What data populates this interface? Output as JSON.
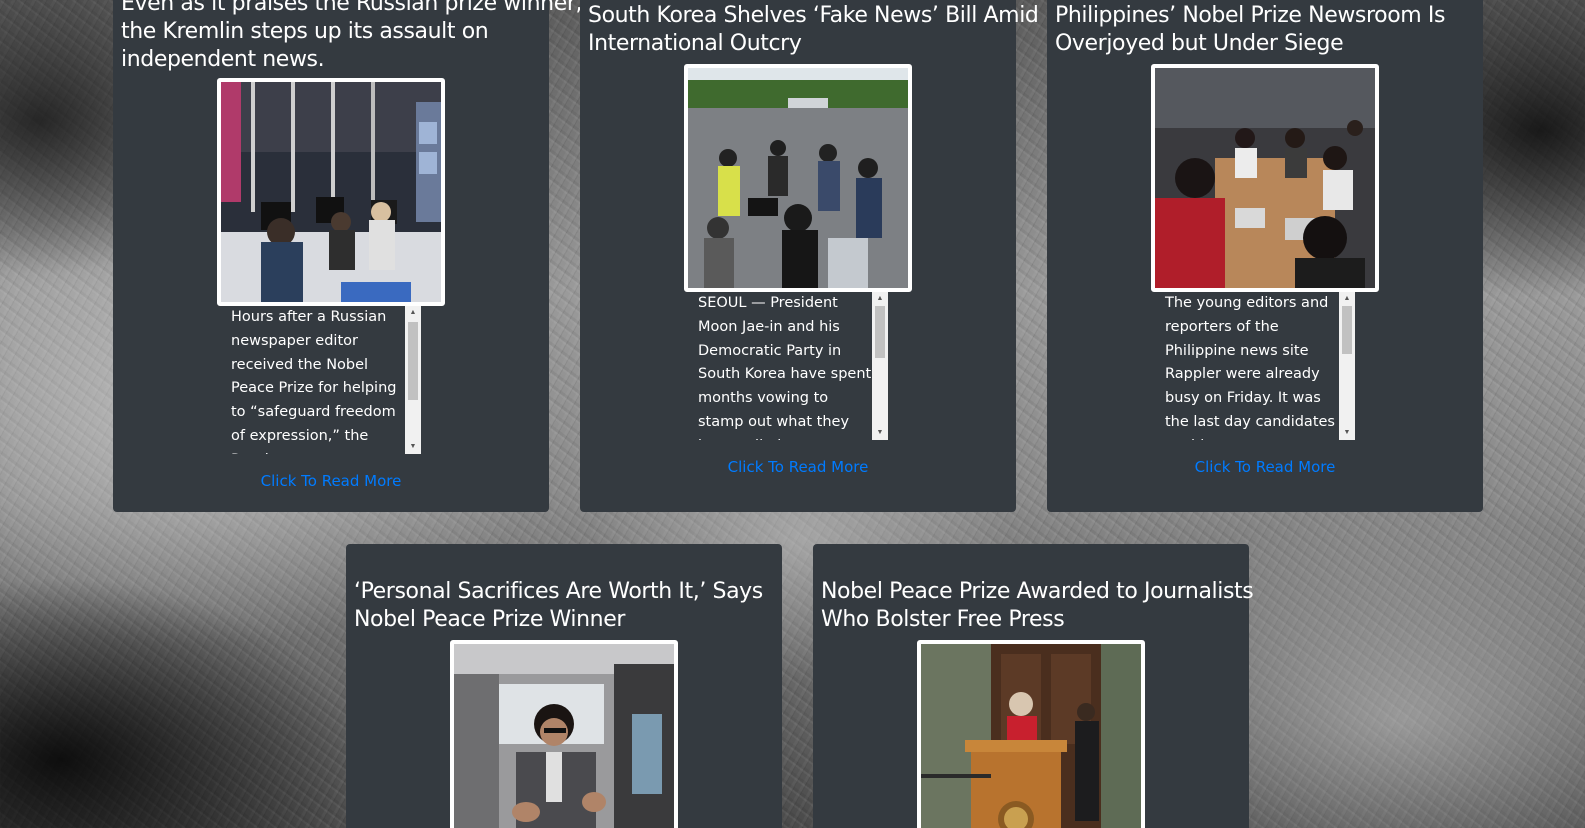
{
  "articles": [
    {
      "title_lines": [
        "Even as it praises the Russian prize winner,",
        "the Kremlin steps up its assault on",
        "independent news."
      ],
      "image": "newsroom-photo",
      "summary": "Hours after a Russian newspaper editor received the Nobel Peace Prize for helping to “safeguard freedom of expression,” the Russian",
      "link": "Click To Read More"
    },
    {
      "title_lines": [
        "South Korea Shelves ‘Fake News’ Bill Amid",
        "International Outcry"
      ],
      "image": "press-crowd-photo",
      "summary": "SEOUL — President Moon Jae-in and his Democratic Party in South Korea have spent months vowing to stamp out what they have called",
      "link": "Click To Read More"
    },
    {
      "title_lines": [
        "Philippines’ Nobel Prize Newsroom Is",
        "Overjoyed but Under Siege"
      ],
      "image": "editors-meeting-photo",
      "summary": "The young editors and reporters of the Philippine news site Rappler were already busy on Friday. It was the last day candidates could",
      "link": "Click To Read More"
    },
    {
      "title_lines": [
        "‘Personal Sacrifices Are Worth It,’ Says",
        "Nobel Peace Prize Winner"
      ],
      "image": "car-interview-photo"
    },
    {
      "title_lines": [
        "Nobel Peace Prize Awarded to Journalists",
        "Who Bolster Free Press"
      ],
      "image": "podium-announcement-photo"
    }
  ],
  "colors": {
    "card_bg": "#343a40",
    "link": "#007bff",
    "text": "#ffffff"
  }
}
